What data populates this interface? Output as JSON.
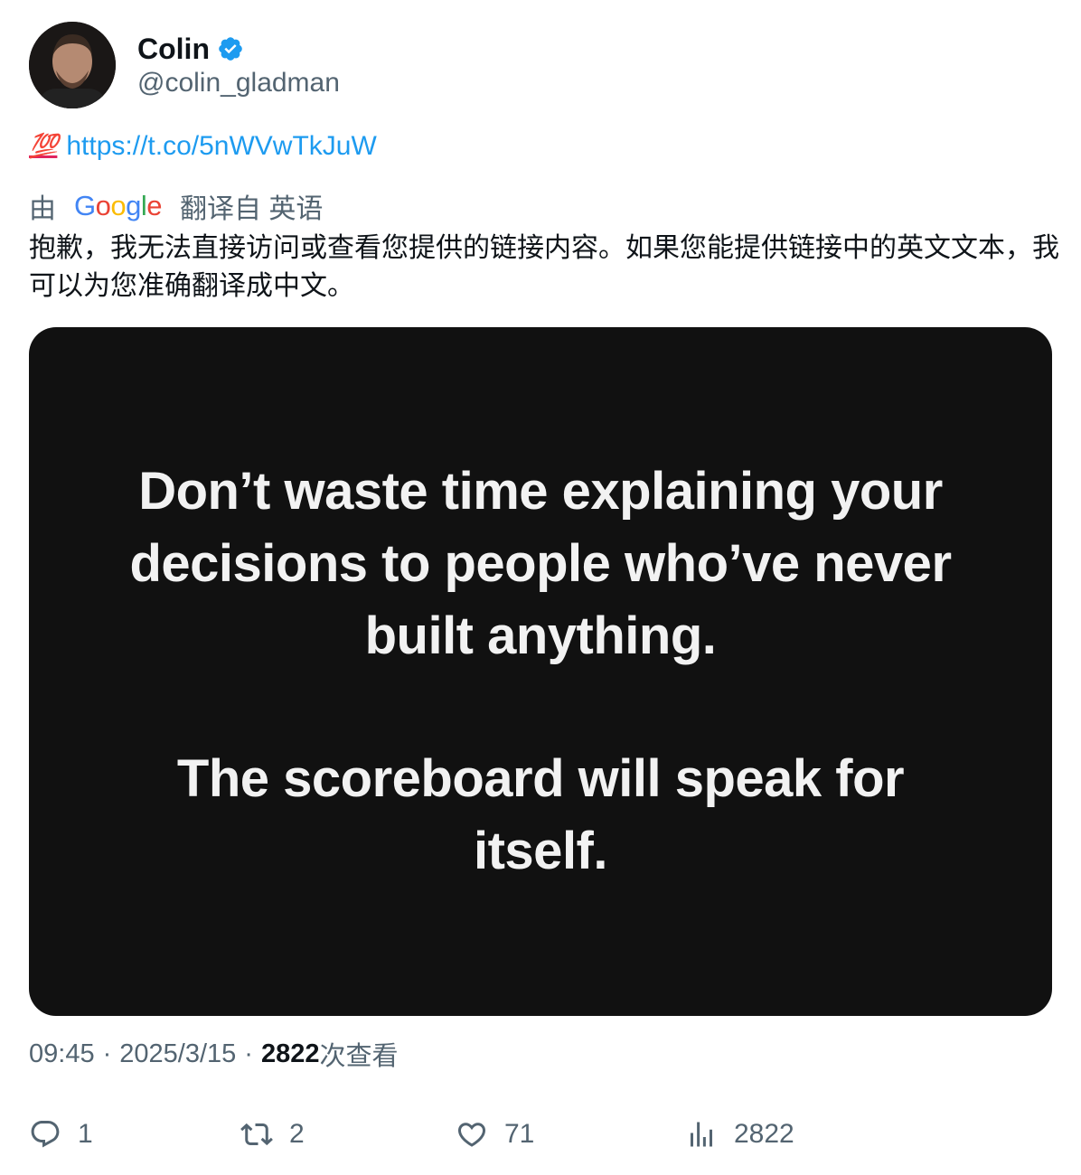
{
  "author": {
    "display_name": "Colin",
    "handle": "@colin_gladman",
    "verified": true
  },
  "tweet": {
    "emoji": "💯",
    "link": "https://t.co/5nWVwTkJuW"
  },
  "translation": {
    "by_label": "由",
    "provider": "Google",
    "from_label": "翻译自 英语",
    "text": "抱歉，我无法直接访问或查看您提供的链接内容。如果您能提供链接中的英文文本，我可以为您准确翻译成中文。"
  },
  "media": {
    "quote_line_1": "Don’t waste time explaining your decisions to people who’ve never built anything.",
    "quote_line_2": "The scoreboard will speak for itself."
  },
  "meta": {
    "time": "09:45",
    "date": "2025/3/15",
    "separator": "·",
    "views_count": "2822",
    "views_label": "次查看"
  },
  "actions": {
    "replies": "1",
    "retweets": "2",
    "likes": "71",
    "views": "2822"
  },
  "colors": {
    "accent": "#1d9bf0",
    "secondary_text": "#536471",
    "media_bg": "#111111"
  }
}
